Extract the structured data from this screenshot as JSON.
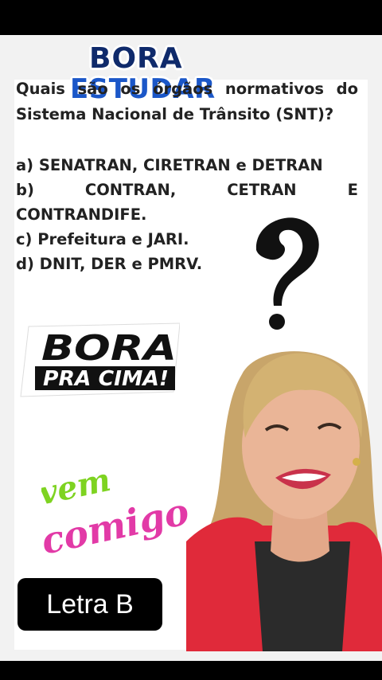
{
  "logo": {
    "line1": "BORA",
    "line2": "ESTUDAR"
  },
  "question": "Quais são os órgãos normativos do Sistema Nacional de Trânsito (SNT)?",
  "options": {
    "a": "a) SENATRAN, CIRETRAN e DETRAN",
    "b_parts": [
      "b)",
      "CONTRAN,",
      "CETRAN",
      "E"
    ],
    "b_line2": "CONTRANDIFE.",
    "c": "c) Prefeitura e JARI.",
    "d": "d) DNIT, DER e PMRV."
  },
  "badge": {
    "line1": "BORA",
    "line2": "PRA CIMA!"
  },
  "sticker": {
    "line1": "vem",
    "line2": "comigo"
  },
  "answer": "Letra B",
  "colors": {
    "logo_dark": "#0f2a6b",
    "logo_blue": "#1b57c8",
    "sticker_green": "#7ed321",
    "sticker_pink": "#e23aa7"
  }
}
